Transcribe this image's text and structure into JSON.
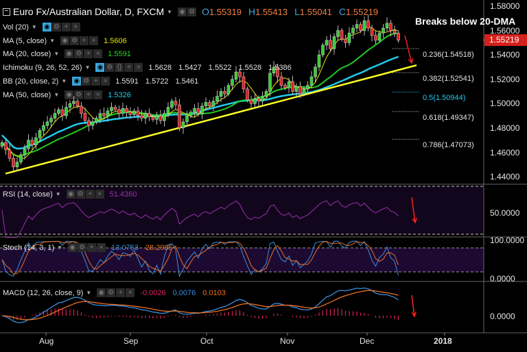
{
  "header": {
    "title": "Euro Fx/Australian Dollar, D, FXCM",
    "open_label": "O",
    "open": "1.55319",
    "high_label": "H",
    "high": "1.55413",
    "low_label": "L",
    "low": "1.55041",
    "close_label": "C",
    "close": "1.55219"
  },
  "legends": {
    "vol": {
      "label": "Vol (20)"
    },
    "ma5": {
      "label": "MA (5, close)",
      "value": "1.5606",
      "color": "#e6e600"
    },
    "ma20": {
      "label": "MA (20, close)",
      "value": "1.5591",
      "color": "#22dd22"
    },
    "ichimoku": {
      "label": "Ichimoku (9, 26, 52, 26)",
      "values": [
        "1.5628",
        "1.5427",
        "1.5522",
        "1.5528",
        "1.5386"
      ]
    },
    "bb": {
      "label": "BB (20, close, 2)",
      "values": [
        "1.5591",
        "1.5722",
        "1.5461"
      ]
    },
    "ma50": {
      "label": "MA (50, close)",
      "value": "1.5326",
      "color": "#22ccee"
    },
    "rsi": {
      "label": "RSI (14, close)",
      "value": "51.4360"
    },
    "stoch": {
      "label": "Stoch (14, 3, 1)",
      "k": "13.0753",
      "d": "28.2985"
    },
    "macd": {
      "label": "MACD (12, 26, close, 9)",
      "hist": "-0.0026",
      "macd": "0.0076",
      "signal": "0.0103"
    }
  },
  "annotation": "Breaks below 20-DMA",
  "fib_levels": [
    {
      "label": "0.236(1.54518)",
      "price": 1.54518
    },
    {
      "label": "0.382(1.52541)",
      "price": 1.52541
    },
    {
      "label": "0.5(1.50944)",
      "price": 1.50944
    },
    {
      "label": "0.618(1.49347)",
      "price": 1.49347
    },
    {
      "label": "0.786(1.47073)",
      "price": 1.47073
    }
  ],
  "price_axis": [
    "1.58000",
    "1.56000",
    "1.54000",
    "1.52000",
    "1.50000",
    "1.48000",
    "1.46000",
    "1.44000"
  ],
  "last_price": "1.55219",
  "rsi_axis": "50.0000",
  "stoch_axis": [
    "100.0000",
    "0.0000"
  ],
  "macd_axis": "0.0000",
  "x_axis": [
    "Aug",
    "Sep",
    "Oct",
    "Nov",
    "Dec",
    "2018"
  ],
  "chart_data": {
    "type": "candlestick",
    "title": "Euro Fx/Australian Dollar, D, FXCM",
    "ylim": [
      1.44,
      1.58
    ],
    "closes": [
      1.468,
      1.462,
      1.455,
      1.448,
      1.452,
      1.458,
      1.463,
      1.47,
      1.466,
      1.472,
      1.478,
      1.482,
      1.485,
      1.488,
      1.492,
      1.495,
      1.49,
      1.497,
      1.5,
      1.502,
      1.498,
      1.492,
      1.486,
      1.482,
      1.485,
      1.488,
      1.492,
      1.49,
      1.494,
      1.497,
      1.495,
      1.492,
      1.496,
      1.493,
      1.491,
      1.494,
      1.49,
      1.488,
      1.492,
      1.489,
      1.487,
      1.49,
      1.486,
      1.492,
      1.497,
      1.502,
      1.499,
      1.48,
      1.485,
      1.49,
      1.493,
      1.496,
      1.492,
      1.498,
      1.501,
      1.498,
      1.502,
      1.506,
      1.51,
      1.508,
      1.515,
      1.52,
      1.526,
      1.522,
      1.512,
      1.503,
      1.5,
      1.504,
      1.502,
      1.506,
      1.51,
      1.525,
      1.53,
      1.522,
      1.515,
      1.513,
      1.518,
      1.51,
      1.514,
      1.508,
      1.512,
      1.515,
      1.522,
      1.53,
      1.54,
      1.548,
      1.552,
      1.545,
      1.555,
      1.56,
      1.553,
      1.55,
      1.558,
      1.562,
      1.565,
      1.56,
      1.568,
      1.562,
      1.556,
      1.552,
      1.558,
      1.562,
      1.566,
      1.56,
      1.558,
      1.552
    ],
    "trendline": {
      "from_price": 1.4425,
      "to_price": 1.5315
    }
  }
}
